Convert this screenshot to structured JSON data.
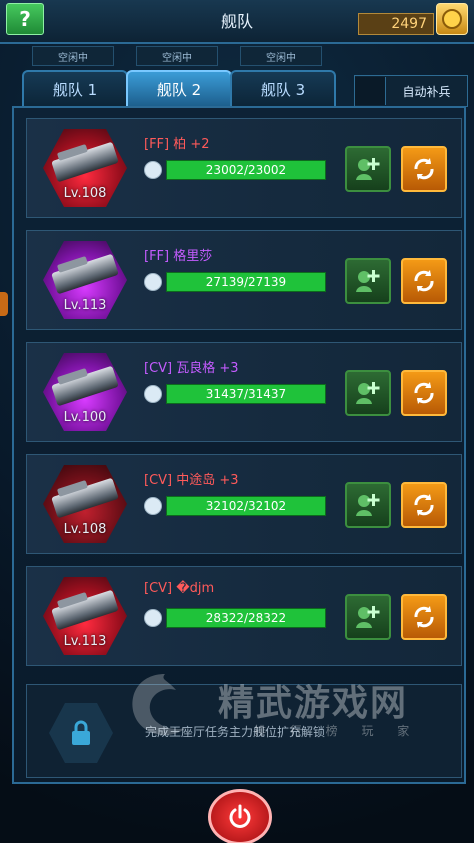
{
  "header": {
    "help_label": "?",
    "title": "舰队",
    "coins": "2497"
  },
  "status_slots": [
    "空闲中",
    "空闲中",
    "空闲中"
  ],
  "tabs": [
    {
      "label": "舰队 1",
      "active": false
    },
    {
      "label": "舰队 2",
      "active": true
    },
    {
      "label": "舰队 3",
      "active": false
    }
  ],
  "auto_refill": {
    "label": "自动补兵"
  },
  "ships": [
    {
      "name": "[FF] 柏 +2",
      "level": "Lv.108",
      "hp": "23002/23002",
      "name_color": "#ff5a5a",
      "frame": "red"
    },
    {
      "name": "[FF] 格里莎",
      "level": "Lv.113",
      "hp": "27139/27139",
      "name_color": "#c45cff",
      "frame": "purple"
    },
    {
      "name": "[CV] 瓦良格 +3",
      "level": "Lv.100",
      "hp": "31437/31437",
      "name_color": "#c45cff",
      "frame": "purple"
    },
    {
      "name": "[CV] 中途岛 +3",
      "level": "Lv.108",
      "hp": "32102/32102",
      "name_color": "#ff5a5a",
      "frame": "red"
    },
    {
      "name": "[CV] �djm",
      "level": "Lv.113",
      "hp": "28322/28322",
      "name_color": "#ff5a5a",
      "frame": "red"
    }
  ],
  "locked_slot": {
    "text": "完成王座厅任务主力舰位扩充解锁"
  },
  "watermark": {
    "title": "精武游戏网",
    "subtitle": "排 行 榜 玩 家"
  }
}
